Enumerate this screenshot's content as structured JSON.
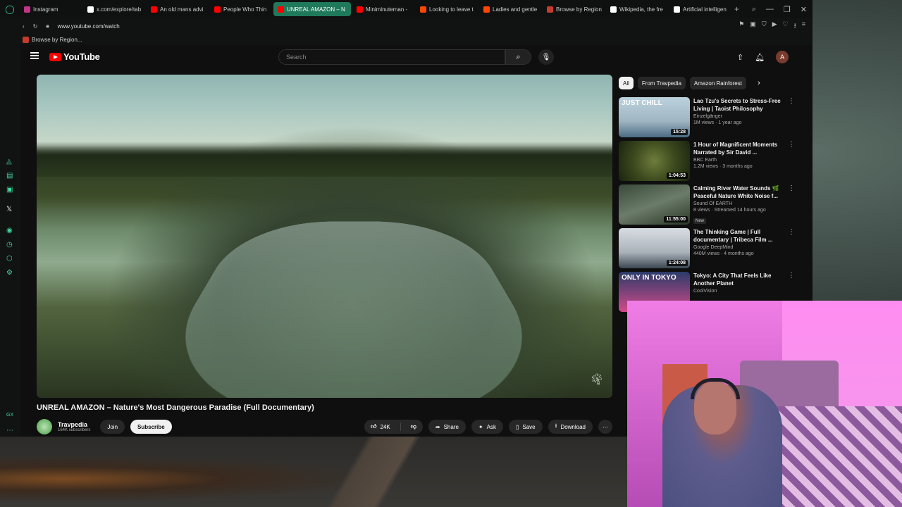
{
  "browser": {
    "tabs": [
      {
        "label": "Instagram",
        "color": "#c13584"
      },
      {
        "label": "x.com/explore/tab",
        "color": "#ffffff"
      },
      {
        "label": "An old mans advi",
        "color": "#ff0000"
      },
      {
        "label": "People Who Thin",
        "color": "#ff0000"
      },
      {
        "label": "UNREAL AMAZON – N",
        "color": "#ff0000",
        "active": true
      },
      {
        "label": "Miniminuteman -",
        "color": "#ff0000"
      },
      {
        "label": "Looking to leave t",
        "color": "#ff4500"
      },
      {
        "label": "Ladies and gentle",
        "color": "#ff4500"
      },
      {
        "label": "Browse by Region",
        "color": "#c63b2b"
      },
      {
        "label": "Wikipedia, the fre",
        "color": "#ffffff"
      },
      {
        "label": "Artificial intelligen",
        "color": "#ffffff"
      }
    ],
    "url": "www.youtube.com/watch",
    "bookmark": "Browse by Region..."
  },
  "youtube": {
    "logo_text": "YouTube",
    "search_placeholder": "Search",
    "avatar_letter": "A",
    "video_title": "UNREAL AMAZON – Nature's Most Dangerous Paradise (Full Documentary)",
    "channel_name": "Travpedia",
    "channel_subs": "164K subscribers",
    "join_label": "Join",
    "subscribe_label": "Subscribe",
    "like_count": "24K",
    "share_label": "Share",
    "ask_label": "Ask",
    "save_label": "Save",
    "download_label": "Download",
    "chips": [
      "All",
      "From Travpedia",
      "Amazon Rainforest"
    ],
    "recommendations": [
      {
        "title": "Lao Tzu's Secrets to Stress-Free Living | Taoist Philosophy",
        "channel": "Einzelgänger",
        "meta": "1M views · 1 year ago",
        "duration": "15:28",
        "overlay": "JUST CHILL",
        "thumb": "linear-gradient(180deg,#bcd3de 0%,#9fb5c2 60%,#4a6b85 100%)"
      },
      {
        "title": "1 Hour of Magnificent Moments Narrated by Sir David ...",
        "channel": "BBC Earth",
        "meta": "1.2M views · 3 months ago",
        "duration": "1:04:53",
        "overlay": "",
        "thumb": "radial-gradient(circle at 50% 50%,#6e7d3c 0%,#3c4a1e 50%,#1b2410 100%)"
      },
      {
        "title": "Calming River Water Sounds 🌿 Peaceful Nature White Noise f...",
        "channel": "Sound Of EARTH",
        "meta": "8 views · Streamed 14 hours ago",
        "duration": "11:55:00",
        "overlay": "",
        "badge": "New",
        "thumb": "linear-gradient(160deg,#3a4a3a 0%,#6c7c6a 50%,#2a3626 100%)"
      },
      {
        "title": "The Thinking Game | Full documentary | Tribeca Film ...",
        "channel": "Google DeepMind",
        "meta": "440M views · 4 months ago",
        "duration": "1:24:08",
        "overlay": "",
        "thumb": "linear-gradient(180deg,#d8dde2 0%,#aab2ba 60%,#3c4852 100%)"
      },
      {
        "title": "Tokyo: A City That Feels Like Another Planet",
        "channel": "CoolVision",
        "meta": "",
        "duration": "",
        "overlay": "ONLY IN TOKYO",
        "thumb": "linear-gradient(180deg,#2c3b6a 0%,#d24a8a 100%)"
      }
    ]
  },
  "colors": {
    "accent": "#ff0000",
    "opera": "#3fd9a0",
    "active_tab": "#1f7a5c"
  }
}
